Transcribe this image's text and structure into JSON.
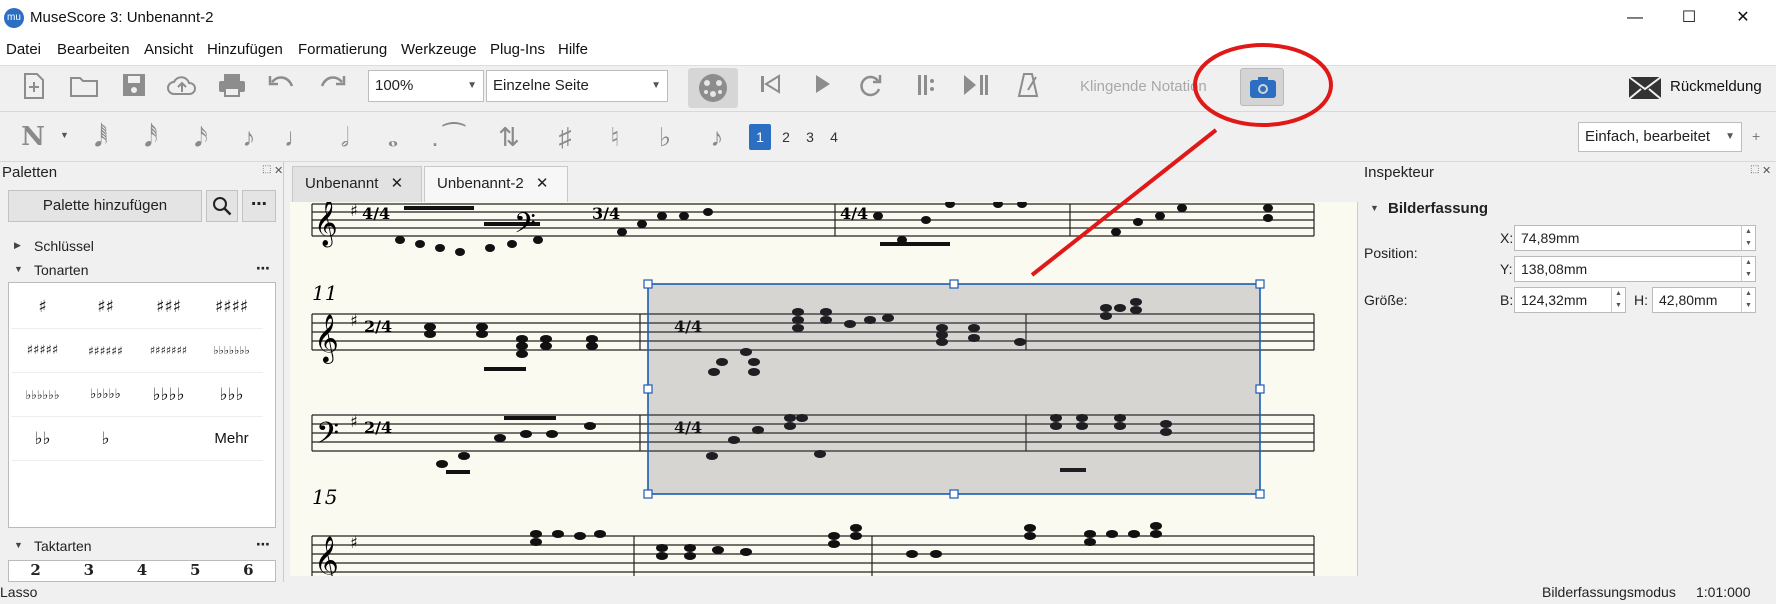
{
  "window": {
    "title": "MuseScore 3: Unbenannt-2",
    "logo_text": "mu",
    "minimize": "—",
    "maximize": "☐",
    "close": "✕"
  },
  "menu": [
    "Datei",
    "Bearbeiten",
    "Ansicht",
    "Hinzufügen",
    "Formatierung",
    "Werkzeuge",
    "Plug-Ins",
    "Hilfe"
  ],
  "toolbar": {
    "zoom": "100%",
    "view_mode": "Einzelne Seite",
    "concert_pitch": "Klingende Notation",
    "feedback": "Rückmeldung",
    "icons": [
      "new-file-icon",
      "open-folder-icon",
      "save-icon",
      "cloud-upload-icon",
      "print-icon",
      "undo-icon",
      "redo-icon",
      "mixer-icon",
      "rewind-icon",
      "play-icon",
      "loop-icon",
      "loop-in-icon",
      "loop-out-icon",
      "metronome-icon",
      "image-capture-icon"
    ]
  },
  "note_input": {
    "voices": [
      "1",
      "2",
      "3",
      "4"
    ],
    "workspace": "Einfach, bearbeitet",
    "add": "+"
  },
  "palettes": {
    "title": "Paletten",
    "add_button": "Palette hinzufügen",
    "sections": [
      {
        "label": "Schlüssel",
        "expanded": false
      },
      {
        "label": "Tonarten",
        "expanded": true
      },
      {
        "label": "Taktarten",
        "expanded": true
      }
    ],
    "key_signatures": [
      "♯",
      "♯♯",
      "♯♯♯",
      "♯♯♯♯",
      "♯♯♯♯♯",
      "♯♯♯♯♯♯",
      "♯♯♯♯♯♯♯",
      "♭♭♭♭♭♭♭",
      "♭♭♭♭♭♭",
      "♭♭♭♭♭",
      "♭♭♭♭",
      "♭♭♭",
      "♭♭",
      "♭",
      ""
    ],
    "more": "Mehr",
    "time_signatures": [
      "2",
      "3",
      "4",
      "5",
      "6"
    ]
  },
  "tabs": [
    {
      "label": "Unbenannt",
      "close": "✕",
      "active": false
    },
    {
      "label": "Unbenannt-2",
      "close": "✕",
      "active": true
    }
  ],
  "score": {
    "measure_numbers": [
      "11",
      "15"
    ],
    "time_sigs": [
      "4/4",
      "3/4",
      "4/4",
      "2/4",
      "4/4"
    ]
  },
  "inspector": {
    "title": "Inspekteur",
    "section": "Bilderfassung",
    "position_label": "Position:",
    "size_label": "Größe:",
    "x_label": "X:",
    "x_value": "74,89mm",
    "y_label": "Y:",
    "y_value": "138,08mm",
    "w_label": "B:",
    "w_value": "124,32mm",
    "h_label": "H:",
    "h_value": "42,80mm"
  },
  "status": {
    "left": "Lasso",
    "mode": "Bilderfassungsmodus",
    "position": "1:01:000"
  },
  "colors": {
    "annotation": "#e01818",
    "selection": "#1a5cb4",
    "accent": "#2c6fc2"
  }
}
